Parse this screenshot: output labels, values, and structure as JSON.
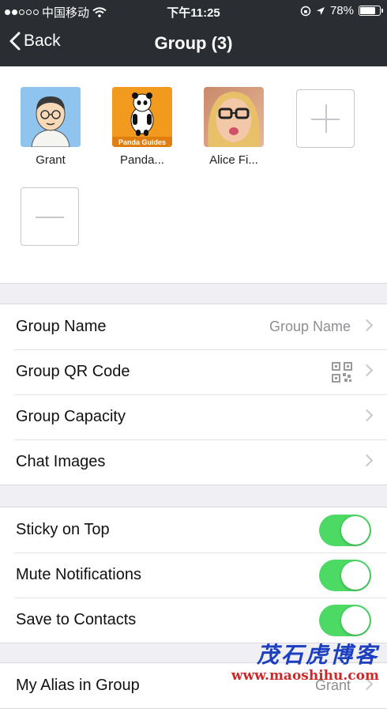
{
  "status_bar": {
    "carrier": "中国移动",
    "time": "下午11:25",
    "battery": "78%",
    "battery_level": 0.78
  },
  "nav": {
    "back_label": "Back",
    "title": "Group (3)"
  },
  "members": [
    {
      "name": "Grant",
      "avatar": "cartoon-man-glasses"
    },
    {
      "name": "Panda...",
      "avatar": "panda-guides-logo",
      "avatar_text": "Panda Guides"
    },
    {
      "name": "Alice Fi...",
      "avatar": "woman-photo"
    }
  ],
  "settings_group1": [
    {
      "title": "Group Name",
      "value": "Group Name"
    },
    {
      "title": "Group QR Code",
      "icon": "qr-code-icon"
    },
    {
      "title": "Group Capacity"
    },
    {
      "title": "Chat Images"
    }
  ],
  "settings_group2": [
    {
      "title": "Sticky on Top",
      "on": true
    },
    {
      "title": "Mute Notifications",
      "on": true
    },
    {
      "title": "Save to Contacts",
      "on": true
    }
  ],
  "settings_group3": [
    {
      "title": "My Alias in Group",
      "value": "Grant"
    }
  ],
  "watermark": {
    "line1": "茂石虎博客",
    "line2": "www.maoshihu.com"
  },
  "colors": {
    "nav_bg": "#2a2d31",
    "toggle_on": "#4cd964",
    "page_bg": "#efeff4"
  }
}
